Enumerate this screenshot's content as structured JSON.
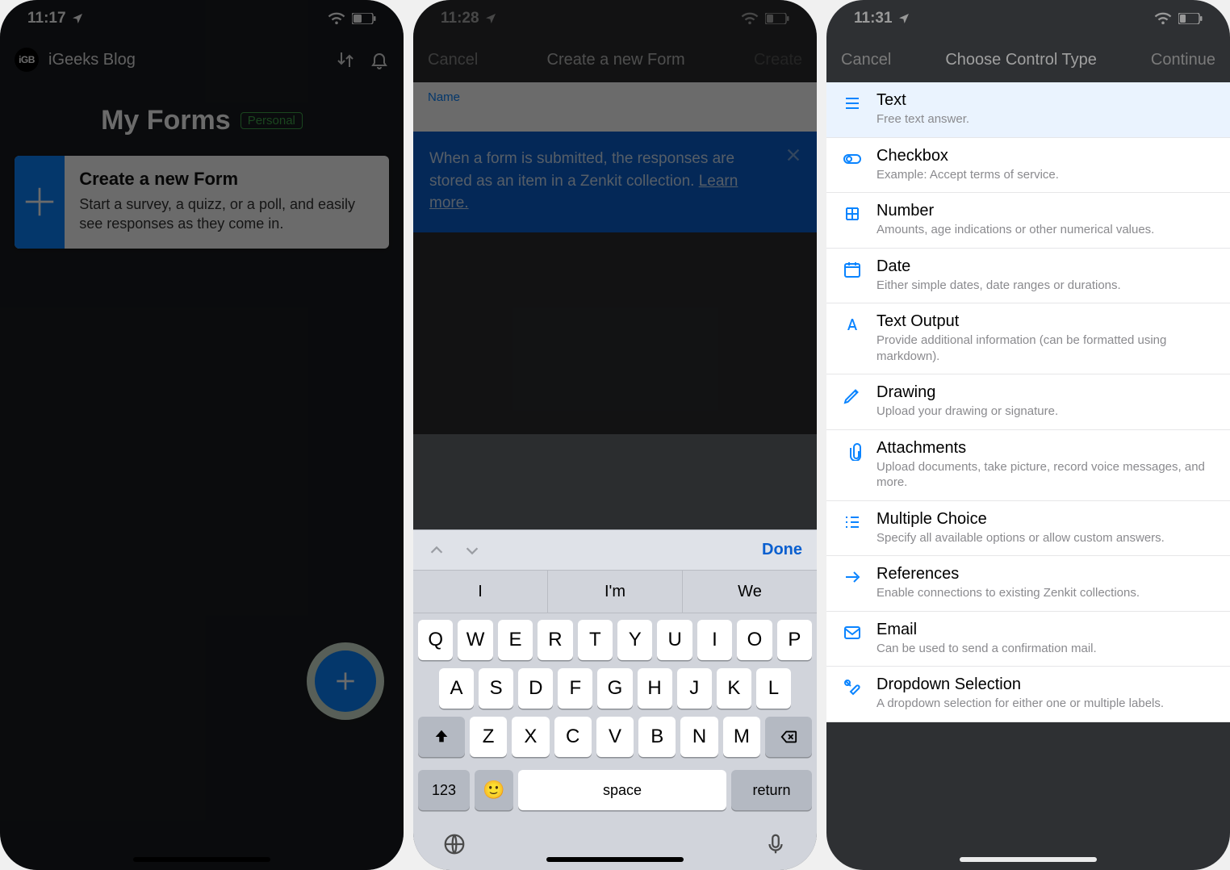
{
  "status": {
    "times": [
      "11:17",
      "11:28",
      "11:31"
    ]
  },
  "screen1": {
    "brand": "iGeeks Blog",
    "title": "My Forms",
    "tag": "Personal",
    "card_title": "Create a new Form",
    "card_desc": "Start a survey, a quizz, or a poll, and easily see responses as they come in."
  },
  "screen2": {
    "nav_cancel": "Cancel",
    "nav_title": "Create a new Form",
    "nav_create": "Create",
    "name_label": "Name",
    "info_text": "When a form is submitted, the responses are stored as an item in a Zenkit collection. ",
    "info_link": "Learn more.",
    "kb_done": "Done",
    "kb_suggestions": [
      "I",
      "I'm",
      "We"
    ],
    "kb_row1": [
      "Q",
      "W",
      "E",
      "R",
      "T",
      "Y",
      "U",
      "I",
      "O",
      "P"
    ],
    "kb_row2": [
      "A",
      "S",
      "D",
      "F",
      "G",
      "H",
      "J",
      "K",
      "L"
    ],
    "kb_row3": [
      "Z",
      "X",
      "C",
      "V",
      "B",
      "N",
      "M"
    ],
    "kb_123": "123",
    "kb_space": "space",
    "kb_return": "return"
  },
  "screen3": {
    "nav_cancel": "Cancel",
    "nav_title": "Choose Control Type",
    "nav_continue": "Continue",
    "types": [
      {
        "title": "Text",
        "desc": "Free text answer."
      },
      {
        "title": "Checkbox",
        "desc": "Example: Accept terms of service."
      },
      {
        "title": "Number",
        "desc": "Amounts, age indications or other numerical values."
      },
      {
        "title": "Date",
        "desc": "Either simple dates, date ranges or durations."
      },
      {
        "title": "Text Output",
        "desc": "Provide additional information (can be formatted using markdown)."
      },
      {
        "title": "Drawing",
        "desc": "Upload your drawing or signature."
      },
      {
        "title": "Attachments",
        "desc": "Upload documents, take picture, record voice messages, and more."
      },
      {
        "title": "Multiple Choice",
        "desc": "Specify all available options or allow custom answers."
      },
      {
        "title": "References",
        "desc": "Enable connections to existing Zenkit collections."
      },
      {
        "title": "Email",
        "desc": "Can be used to send a confirmation mail."
      },
      {
        "title": "Dropdown Selection",
        "desc": "A dropdown selection for either one or multiple labels."
      }
    ]
  }
}
